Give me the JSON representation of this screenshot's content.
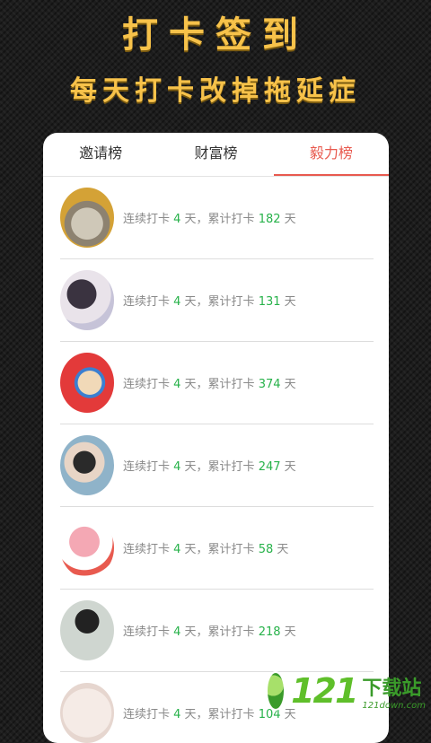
{
  "hero": {
    "title": "打卡签到",
    "subtitle": "每天打卡改掉拖延症"
  },
  "tabs": [
    {
      "label": "邀请榜"
    },
    {
      "label": "财富榜"
    },
    {
      "label": "毅力榜"
    }
  ],
  "list": {
    "prefix": "连续打卡 ",
    "streak_unit": " 天，累计打卡 ",
    "total_unit": " 天",
    "items": [
      {
        "streak": "4",
        "total": "182"
      },
      {
        "streak": "4",
        "total": "131"
      },
      {
        "streak": "4",
        "total": "374"
      },
      {
        "streak": "4",
        "total": "247"
      },
      {
        "streak": "4",
        "total": "58"
      },
      {
        "streak": "4",
        "total": "218"
      },
      {
        "streak": "4",
        "total": "104"
      }
    ]
  },
  "watermark": {
    "number": "121",
    "cn": "下载站",
    "en": "121down.com"
  }
}
